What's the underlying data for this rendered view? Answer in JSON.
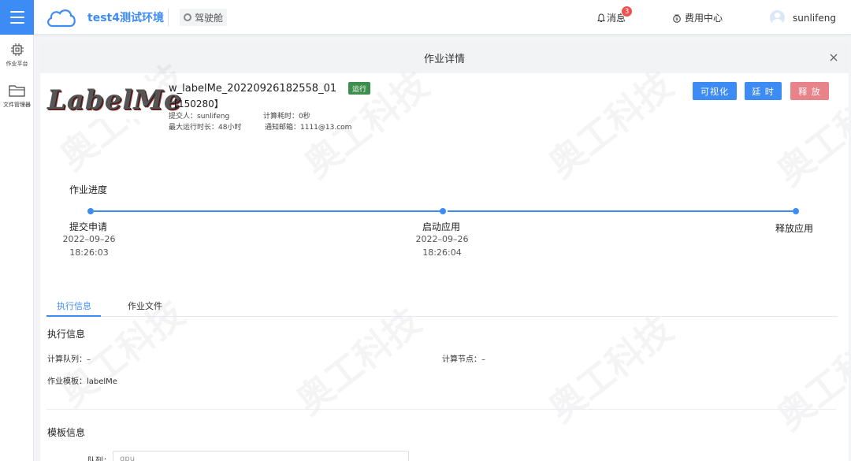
{
  "header": {
    "app_title": "test4测试环境",
    "cockpit_label": "驾驶舱",
    "messages_label": "消息",
    "messages_count": "3",
    "fee_center_label": "费用中心",
    "username": "sunlifeng"
  },
  "sidebar": {
    "items": [
      {
        "label": "作业平台",
        "icon": "chip-icon"
      },
      {
        "label": "文件管理器",
        "icon": "folder-icon"
      }
    ]
  },
  "panel": {
    "title": "作业详情",
    "job": {
      "logo_text": "LabelMe",
      "name": "w_labelMe_20220926182558_01",
      "id": "【150280】",
      "status": "运行",
      "submitter": "提交人：sunlifeng",
      "compute_time": "计算耗时：0秒",
      "max_runtime": "最大运行时长：48小时",
      "notify_email": "通知邮箱：1111@13.com"
    },
    "actions": {
      "visualize": "可视化",
      "extend": "延 时",
      "release": "释 放"
    },
    "progress": {
      "title": "作业进度",
      "steps": [
        {
          "label": "提交申请",
          "date": "2022–09–26",
          "time": "18:26:03"
        },
        {
          "label": "启动应用",
          "date": "2022–09–26",
          "time": "18:26:04"
        },
        {
          "label": "释放应用",
          "date": "",
          "time": ""
        }
      ]
    },
    "tabs": [
      "执行信息",
      "作业文件"
    ],
    "exec_info": {
      "title": "执行信息",
      "queue": "计算队列：–",
      "node": "计算节点：–",
      "template": "作业模板：labelMe"
    },
    "template_info": {
      "title": "模板信息",
      "queue_label": "队列：",
      "queue_value": "gpu"
    },
    "watermark": "奥工科技"
  },
  "colors": {
    "primary": "#3d8bf5",
    "status_running": "#3f8f4c",
    "danger": "#e8838a",
    "badge": "#f05050"
  }
}
